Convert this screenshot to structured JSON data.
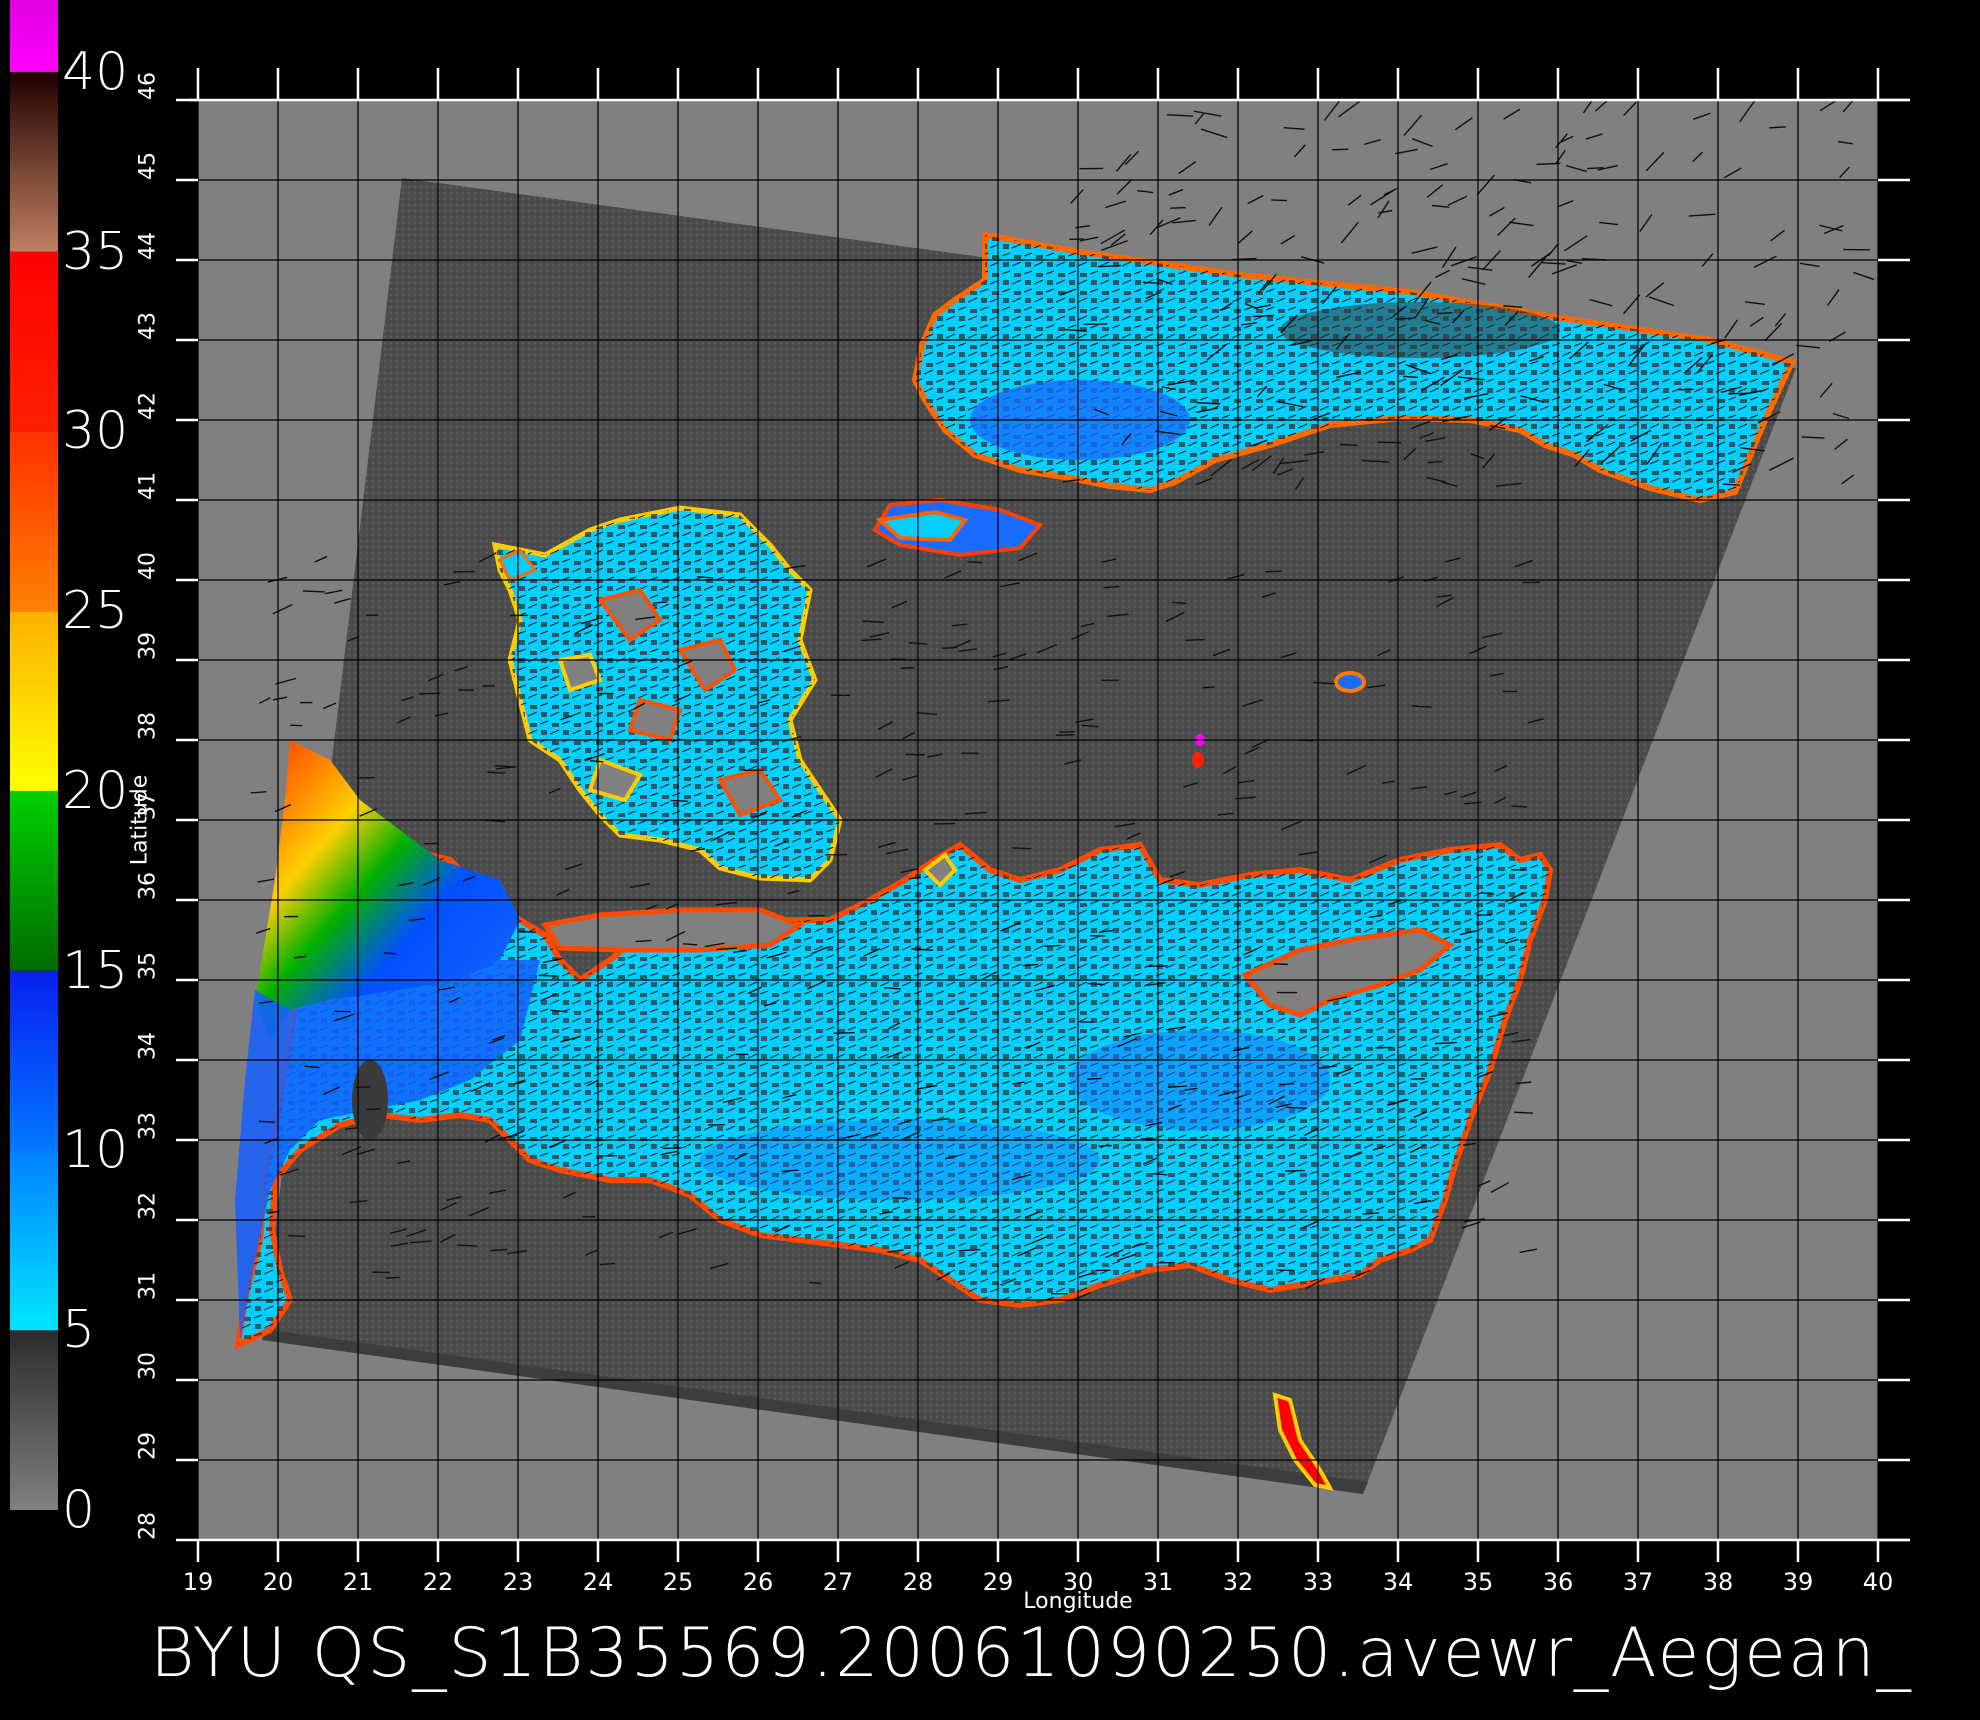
{
  "caption": "BYU QS_S1B35569.20061090250.avewr_Aegean_",
  "axes": {
    "xlabel": "Longitude",
    "ylabel": "Latitude",
    "lon_range": [
      19,
      40
    ],
    "lat_range": [
      28,
      46
    ],
    "lon_ticks": [
      "19",
      "20",
      "21",
      "22",
      "23",
      "24",
      "25",
      "26",
      "27",
      "28",
      "29",
      "30",
      "31",
      "32",
      "33",
      "34",
      "35",
      "36",
      "37",
      "38",
      "39",
      "40"
    ],
    "lat_ticks": [
      "28",
      "29",
      "30",
      "31",
      "32",
      "33",
      "34",
      "35",
      "36",
      "37",
      "38",
      "39",
      "40",
      "41",
      "42",
      "43",
      "44",
      "45",
      "46"
    ],
    "grid": true
  },
  "colorbar": {
    "labels": [
      "40",
      "35",
      "30",
      "25",
      "20",
      "15",
      "10",
      "5",
      "0"
    ],
    "placement": "left",
    "bands": [
      {
        "from": 0,
        "to": 5,
        "colors": [
          "#808080",
          "#2b2b2b"
        ]
      },
      {
        "from": 5,
        "to": 10,
        "colors": [
          "#00e6ff",
          "#0080ff"
        ]
      },
      {
        "from": 10,
        "to": 15,
        "colors": [
          "#0078ff",
          "#0a1ef0"
        ]
      },
      {
        "from": 15,
        "to": 20,
        "colors": [
          "#006a00",
          "#00d000"
        ]
      },
      {
        "from": 20,
        "to": 25,
        "colors": [
          "#ffff00",
          "#ffb000"
        ]
      },
      {
        "from": 25,
        "to": 30,
        "colors": [
          "#ff8000",
          "#ff3000"
        ]
      },
      {
        "from": 30,
        "to": 35,
        "colors": [
          "#ff2000",
          "#ff0000"
        ]
      },
      {
        "from": 35,
        "to": 40,
        "colors": [
          "#c08060",
          "#200000"
        ]
      },
      {
        "from": 40,
        "to": 42,
        "colors": [
          "#ff00ff",
          "#e000e0"
        ]
      }
    ]
  },
  "colors": {
    "background": "#000000",
    "land": "#808080",
    "swath": "#4a4a4a",
    "sea_low": "#00d8ff",
    "sea_mid": "#1a6bff",
    "low_wind": "#3a3a3a",
    "grid": "#000000"
  }
}
